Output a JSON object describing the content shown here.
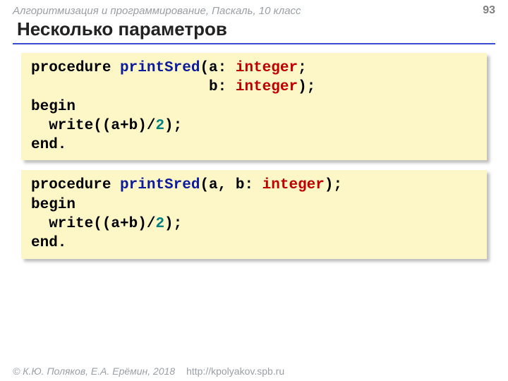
{
  "header": {
    "course": "Алгоритмизация и программирование, Паскаль, 10 класс",
    "page": "93"
  },
  "title": "Несколько параметров",
  "code1": {
    "l1a": "procedure ",
    "l1b": "printSred",
    "l1c": "(a: ",
    "l1d": "integer",
    "l1e": ";",
    "l2a": "                    b: ",
    "l2b": "integer",
    "l2c": ");",
    "l3": "begin",
    "l4a": "  write((a+b)/",
    "l4b": "2",
    "l4c": ");",
    "l5": "end."
  },
  "code2": {
    "l1a": "procedure ",
    "l1b": "printSred",
    "l1c": "(a, b: ",
    "l1d": "integer",
    "l1e": ");",
    "l2": "begin",
    "l3a": "  write((a+b)/",
    "l3b": "2",
    "l3c": ");",
    "l4": "end."
  },
  "footer": {
    "authors": "© К.Ю. Поляков, Е.А. Ерёмин, 2018",
    "url": "http://kpolyakov.spb.ru"
  }
}
